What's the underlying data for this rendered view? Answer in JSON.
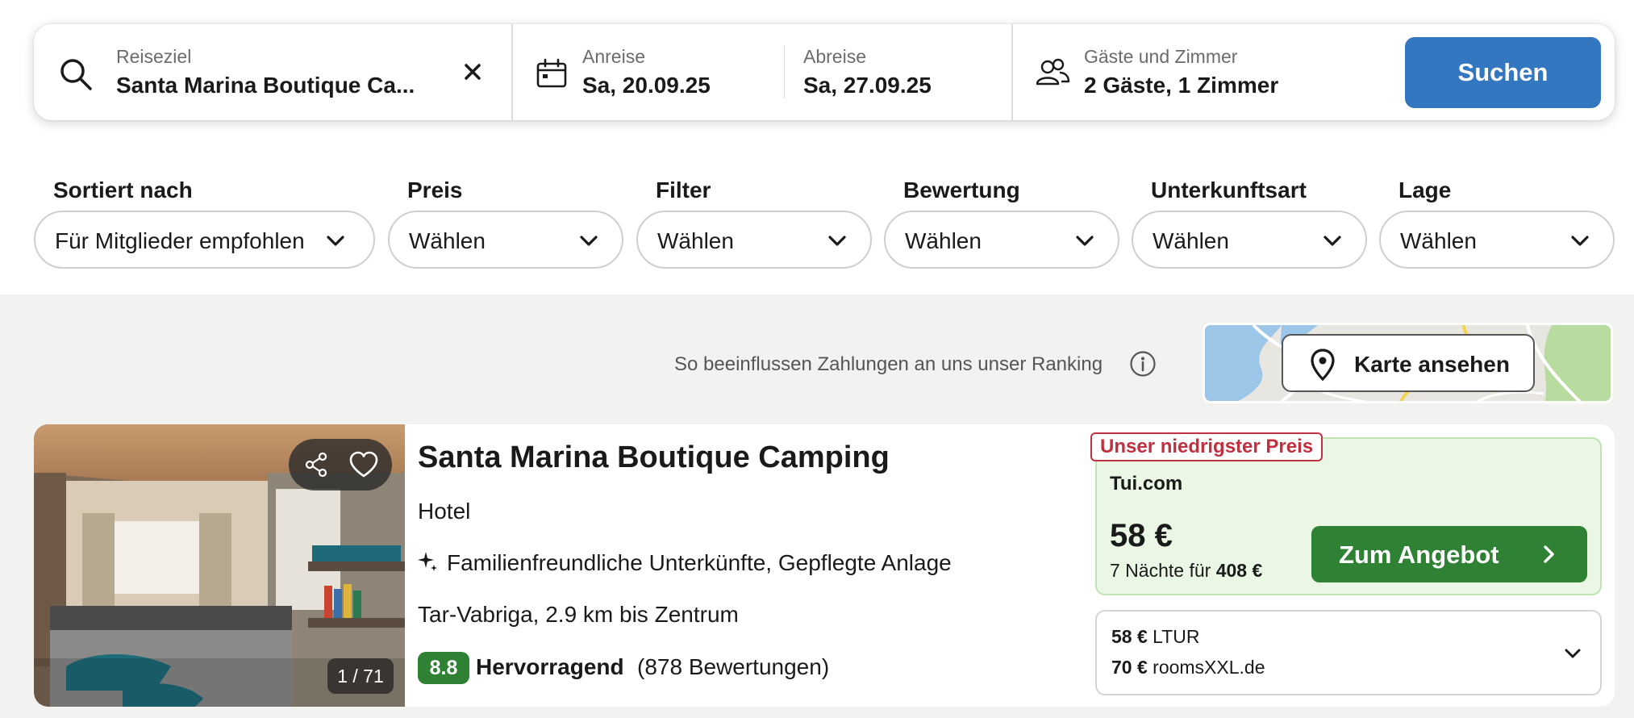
{
  "search": {
    "destination_label": "Reiseziel",
    "destination_value": "Santa Marina Boutique Ca...",
    "checkin_label": "Anreise",
    "checkin_value": "Sa, 20.09.25",
    "checkout_label": "Abreise",
    "checkout_value": "Sa, 27.09.25",
    "guests_label": "Gäste und Zimmer",
    "guests_value": "2 Gäste, 1 Zimmer",
    "search_button": "Suchen"
  },
  "filters": [
    {
      "label": "Sortiert nach",
      "value": "Für Mitglieder empfohlen"
    },
    {
      "label": "Preis",
      "value": "Wählen"
    },
    {
      "label": "Filter",
      "value": "Wählen"
    },
    {
      "label": "Bewertung",
      "value": "Wählen"
    },
    {
      "label": "Unterkunftsart",
      "value": "Wählen"
    },
    {
      "label": "Lage",
      "value": "Wählen"
    }
  ],
  "ranking_note": "So beeinflussen Zahlungen an uns unser Ranking",
  "map_button": "Karte ansehen",
  "result": {
    "name": "Santa Marina Boutique Camping",
    "type": "Hotel",
    "features": "Familienfreundliche Unterkünfte, Gepflegte Anlage",
    "location": "Tar-Vabriga, 2.9 km bis Zentrum",
    "rating_score": "8.8",
    "rating_word": "Hervorragend",
    "rating_count": "(878 Bewertungen)",
    "photo_counter": "1 / 71",
    "deal": {
      "tag": "Unser niedrigster Preis",
      "provider": "Tui.com",
      "price": "58 €",
      "nights_prefix": "7 Nächte für",
      "nights_total": "408 €",
      "button": "Zum Angebot"
    },
    "other_deals": [
      {
        "price": "58 €",
        "provider": "LTUR"
      },
      {
        "price": "70 €",
        "provider": "roomsXXL.de"
      }
    ]
  },
  "colors": {
    "primary_blue": "#3277c0",
    "deal_green": "#2f8234",
    "deal_bg": "#e9f7e4",
    "tag_red": "#c0303f"
  }
}
